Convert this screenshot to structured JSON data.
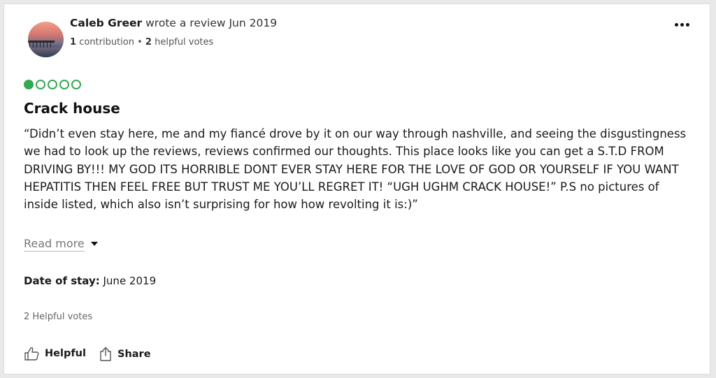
{
  "review": {
    "author_name": "Caleb Greer",
    "action_text": "wrote a review Jun 2019",
    "contributions": "1",
    "contributions_label": "contribution",
    "separator": " • ",
    "helpful_votes_count": "2",
    "helpful_votes_label": "helpful votes",
    "rating": 1,
    "rating_max": 5,
    "rating_color": "#34a853",
    "title": "Crack house",
    "text": "“Didn’t even stay here, me and my fiancé drove by it on our way through nashville, and seeing the disgustingness we had to look up the reviews, reviews confirmed our thoughts. This place looks like you can get a S.T.D FROM DRIVING BY!!! MY GOD ITS HORRIBLE DONT EVER STAY HERE FOR THE LOVE OF GOD OR YOURSELF IF YOU WANT HEPATITIS THEN FEEL FREE BUT TRUST ME YOU’LL REGRET IT! “UGH UGHM CRACK HOUSE!” P.S no pictures of inside listed, which also isn’t surprising for how how revolting it is:)”",
    "read_more_label": "Read more",
    "date_of_stay_label": "Date of stay:",
    "date_of_stay_value": " June 2019",
    "helpful_votes_text": "2 Helpful votes"
  },
  "actions": {
    "helpful_label": "Helpful",
    "share_label": "Share"
  },
  "icons": {
    "more": "more-options-icon",
    "helpful": "thumbs-up-icon",
    "share": "share-icon",
    "caret": "caret-down-icon"
  }
}
